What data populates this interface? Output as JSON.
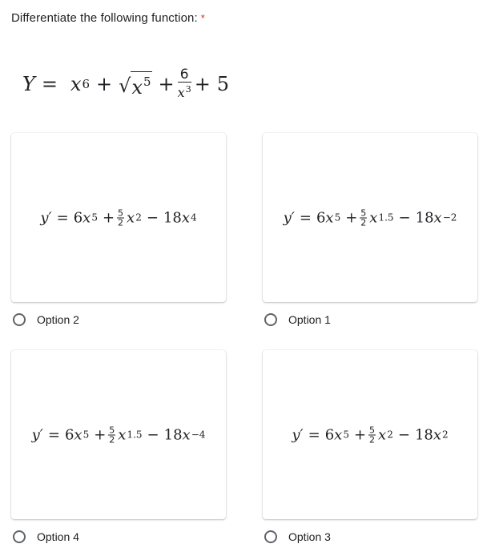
{
  "question": {
    "text": "Differentiate the following function:",
    "required_marker": "*",
    "function": {
      "lhs": "Y",
      "eq": "=",
      "t1_base": "x",
      "t1_exp": "6",
      "plus": "+",
      "sqrt_symbol": "√",
      "t2_base": "x",
      "t2_exp": "5",
      "frac_num": "6",
      "frac_den_base": "x",
      "frac_den_exp": "3",
      "const": "5"
    }
  },
  "options": [
    {
      "label": "Option 2",
      "selected": false,
      "eq": {
        "lhs": "y′",
        "eq": "=",
        "c1": "6",
        "b1": "x",
        "e1": "5",
        "op1": "+",
        "fn": "5",
        "fd": "2",
        "b2": "x",
        "e2": "2",
        "op2": "−",
        "c3": "18",
        "b3": "x",
        "e3": "4"
      }
    },
    {
      "label": "Option 1",
      "selected": false,
      "eq": {
        "lhs": "y′",
        "eq": "=",
        "c1": "6",
        "b1": "x",
        "e1": "5",
        "op1": "+",
        "fn": "5",
        "fd": "2",
        "b2": "x",
        "e2": "1.5",
        "op2": "−",
        "c3": "18",
        "b3": "x",
        "e3": "−2"
      }
    },
    {
      "label": "Option 4",
      "selected": false,
      "eq": {
        "lhs": "y′",
        "eq": "=",
        "c1": "6",
        "b1": "x",
        "e1": "5",
        "op1": "+",
        "fn": "5",
        "fd": "2",
        "b2": "x",
        "e2": "1.5",
        "op2": "−",
        "c3": "18",
        "b3": "x",
        "e3": "−4"
      }
    },
    {
      "label": "Option 3",
      "selected": false,
      "eq": {
        "lhs": "y′",
        "eq": "=",
        "c1": "6",
        "b1": "x",
        "e1": "5",
        "op1": "+",
        "fn": "5",
        "fd": "2",
        "b2": "x",
        "e2": "2",
        "op2": "−",
        "c3": "18",
        "b3": "x",
        "e3": "2"
      }
    }
  ]
}
